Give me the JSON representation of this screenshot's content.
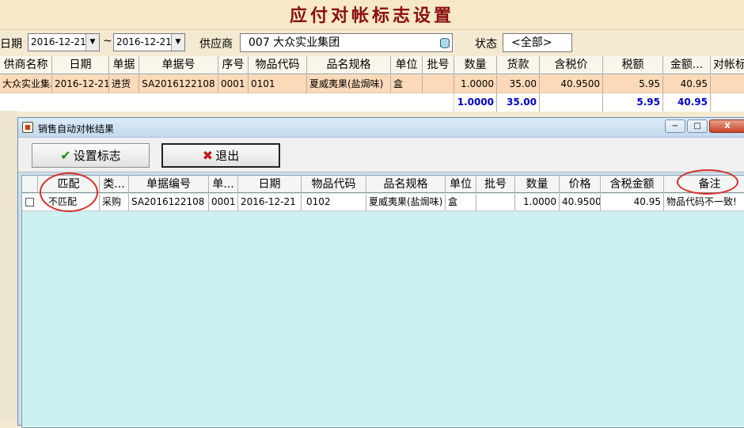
{
  "app_title": "应付对帐标志设置",
  "filter": {
    "date_label": "日期",
    "date_from": "2016-12-21",
    "tilde": "~",
    "date_to": "2016-12-21",
    "supplier_label": "供应商",
    "supplier_value": "007  大众实业集团",
    "status_label": "状态",
    "status_value": "<全部>"
  },
  "main_table": {
    "headers": [
      "供商名称",
      "日期",
      "单据",
      "单据号",
      "序号",
      "物品代码",
      "品名规格",
      "单位",
      "批号",
      "数量",
      "货款",
      "含税价",
      "税额",
      "金额...",
      "对帐标"
    ],
    "row": [
      "大众实业集...",
      "2016-12-21",
      "进货",
      "SA2016122108",
      "0001",
      "0101",
      "夏威夷果(盐焗味)",
      "盒",
      "",
      "1.0000",
      "35.00",
      "40.9500",
      "5.95",
      "40.95",
      ""
    ],
    "totals": {
      "quantity": "1.0000",
      "amount": "35.00",
      "tax": "5.95",
      "total": "40.95"
    }
  },
  "dialog": {
    "title": "销售自动对帐结果",
    "window_controls": {
      "minimize": "−",
      "maximize": "□",
      "close": "X"
    },
    "buttons": {
      "set_flag": "设置标志",
      "exit": "退出"
    },
    "headers": [
      "匹配",
      "类...",
      "单据编号",
      "单...",
      "日期",
      "物品代码",
      "品名规格",
      "单位",
      "批号",
      "数量",
      "价格",
      "含税金额",
      "备注"
    ],
    "row": [
      "不匹配",
      "采购",
      "SA2016122108",
      "0001",
      "2016-12-21",
      "0102",
      "夏威夷果(盐焗味)",
      "盒",
      "",
      "1.0000",
      "40.9500",
      "40.95",
      "物品代码不一致!"
    ]
  },
  "annotation_color": "#d2322c"
}
